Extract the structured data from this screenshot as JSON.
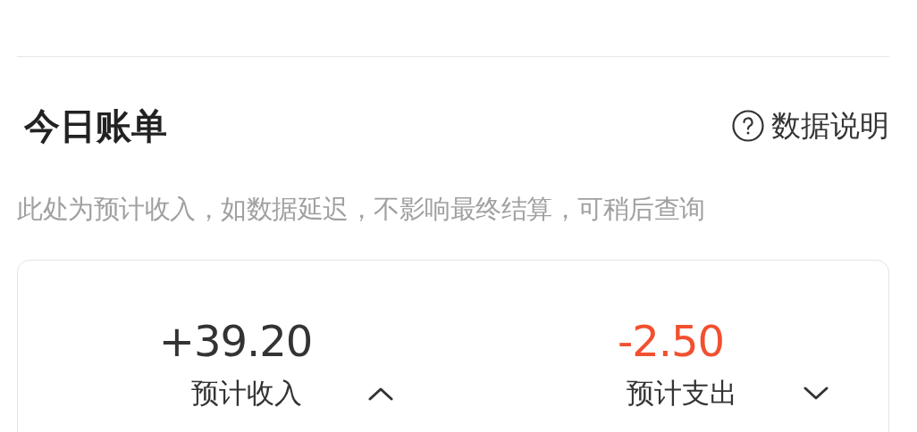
{
  "section": {
    "title": "今日账单",
    "help_link": "数据说明",
    "note": "此处为预计收入，如数据延迟，不影响最终结算，可稍后查询"
  },
  "stats": [
    {
      "amount": "+39.20",
      "label": "预计收入",
      "color": "#333333",
      "expanded": true
    },
    {
      "amount": "-2.50",
      "label": "预计支出",
      "color": "#f2502f",
      "expanded": false
    }
  ]
}
